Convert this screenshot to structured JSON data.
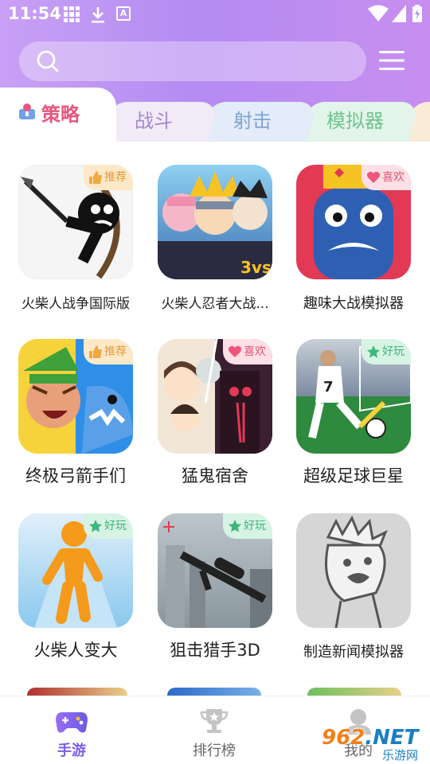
{
  "status_bar": {
    "time": "11:54"
  },
  "search": {
    "placeholder": ""
  },
  "tabs": [
    {
      "label": "策略",
      "active": true
    },
    {
      "label": "战斗"
    },
    {
      "label": "射击"
    },
    {
      "label": "模拟器"
    }
  ],
  "games": [
    {
      "title": "火柴人战争国际版",
      "badge": "推荐",
      "badge_type": "rec"
    },
    {
      "title": "火柴人忍者大战...",
      "badge": "",
      "badge_type": ""
    },
    {
      "title": "趣味大战模拟器",
      "badge": "喜欢",
      "badge_type": "like"
    },
    {
      "title": "终极弓箭手们",
      "badge": "推荐",
      "badge_type": "rec"
    },
    {
      "title": "猛鬼宿舍",
      "badge": "喜欢",
      "badge_type": "like"
    },
    {
      "title": "超级足球巨星",
      "badge": "好玩",
      "badge_type": "fun"
    },
    {
      "title": "火柴人变大",
      "badge": "好玩",
      "badge_type": "fun"
    },
    {
      "title": "狙击猎手3D",
      "badge": "好玩",
      "badge_type": "fun"
    },
    {
      "title": "制造新闻模拟器",
      "badge": "",
      "badge_type": ""
    }
  ],
  "bottom_nav": [
    {
      "label": "手游",
      "icon": "gamepad-icon",
      "active": true
    },
    {
      "label": "排行榜",
      "icon": "trophy-icon"
    },
    {
      "label": "我的",
      "icon": "profile-icon"
    }
  ],
  "watermark": {
    "brand": "962",
    "domain": ".NET",
    "sub": "乐游网"
  },
  "colors": {
    "header_start": "#c9a0f5",
    "header_end": "#c78ef0",
    "accent_active_tab": "#e8567e",
    "nav_active": "#7b5ee8",
    "badge_rec": "#e29b3a",
    "badge_like": "#e55476",
    "badge_fun": "#3fb67a"
  }
}
